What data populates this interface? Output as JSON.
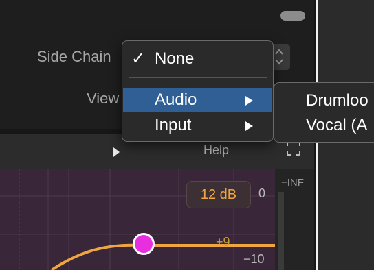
{
  "settings": {
    "side_chain_label": "Side Chain",
    "view_label": "View"
  },
  "toolbar": {
    "help_label": "Help"
  },
  "eq": {
    "gain_value": "12 dB",
    "scale_top": "0",
    "scale_mid": "−10",
    "curve_label": "+9",
    "meter_label": "−INF"
  },
  "menu": {
    "checkmark": "✓",
    "items": [
      {
        "label": "None",
        "checked": true
      },
      {
        "label": "Audio",
        "has_submenu": true,
        "highlighted": true
      },
      {
        "label": "Input",
        "has_submenu": true
      }
    ]
  },
  "submenu": {
    "items": [
      "Drumloo",
      "Vocal (A"
    ]
  },
  "colors": {
    "highlight": "#2f5f94",
    "accent_orange": "#f0a640",
    "handle_magenta": "#e82fe0",
    "eq_background": "#3a2639"
  }
}
